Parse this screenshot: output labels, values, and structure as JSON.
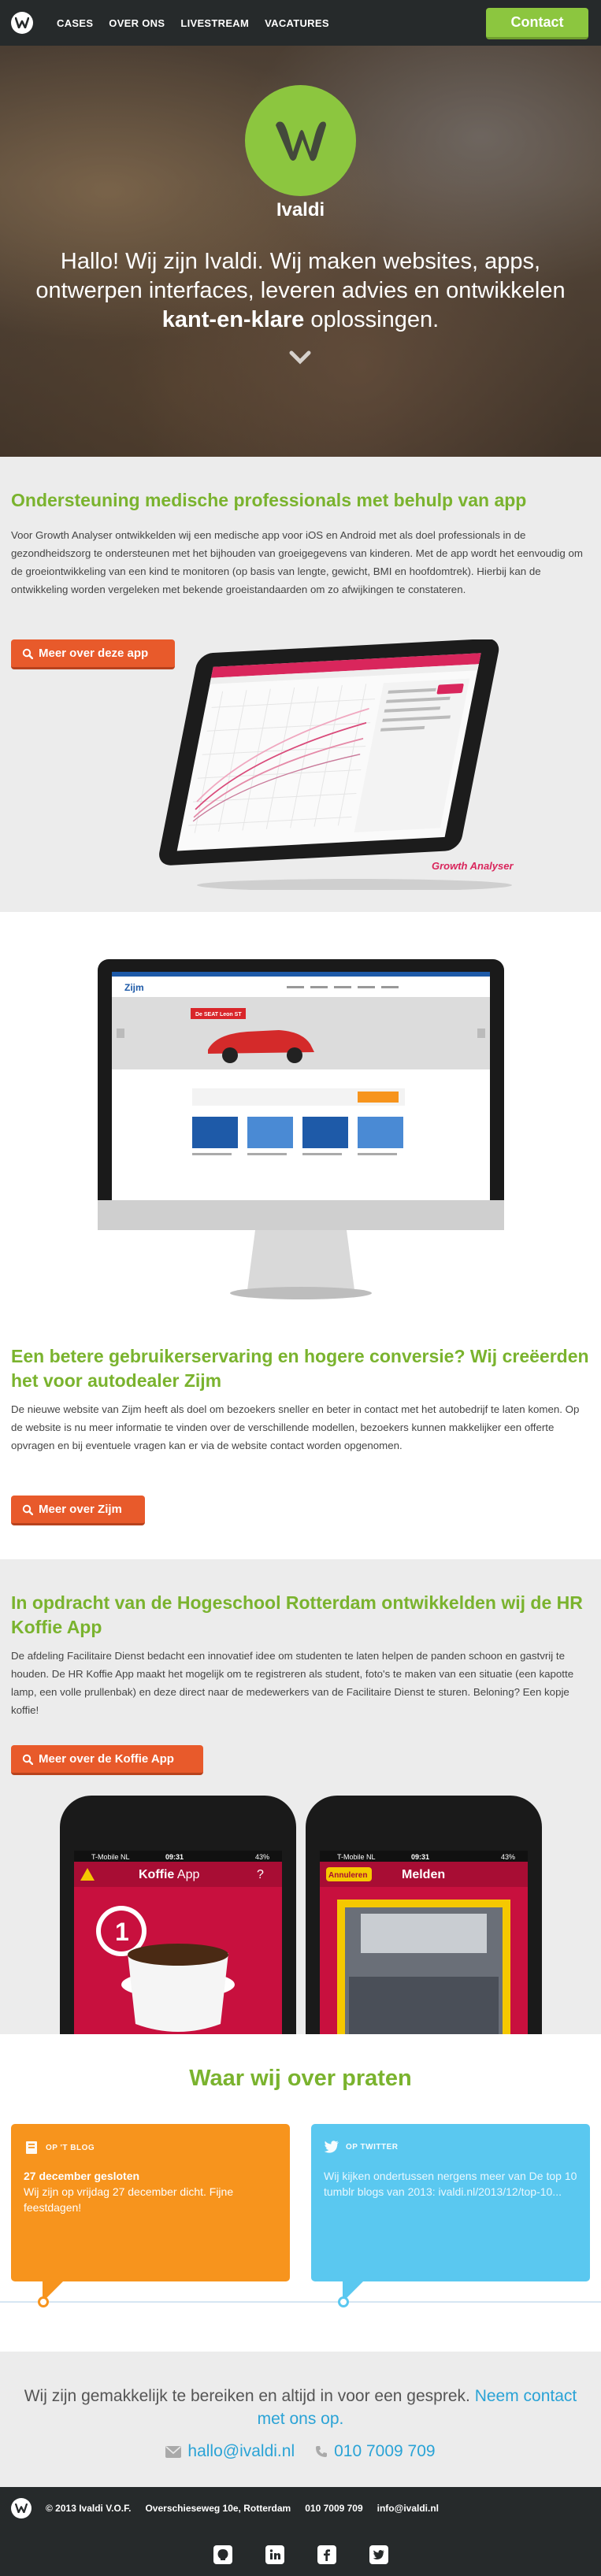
{
  "nav": {
    "links": [
      "CASES",
      "OVER ONS",
      "LIVESTREAM",
      "VACATURES"
    ],
    "contact_label": "Contact"
  },
  "hero": {
    "brand": "Ivaldi",
    "tagline_start": "Hallo! Wij zijn Ivaldi. Wij maken websites, apps, ontwerpen interfaces, leveren advies en ontwikkelen ",
    "tagline_bold": "kant-en-klare",
    "tagline_end": " oplossingen."
  },
  "case1": {
    "title": "Ondersteuning medische professionals met behulp van app",
    "text": "Voor Growth Analyser ontwikkelden wij een medische app voor iOS en Android met als doel professionals in de gezondheidszorg te ondersteunen met het bijhouden van groeigegevens van kinderen. Met de app wordt het eenvoudig om de groeiontwikkeling van een kind te monitoren (op basis van lengte, gewicht, BMI en hoofdomtrek). Hierbij kan de ontwikkeling worden vergeleken met bekende groeistandaarden om zo afwijkingen te constateren.",
    "button": "Meer over deze app",
    "app_brand": "Growth Analyser"
  },
  "case2": {
    "title": "Een betere gebruikerservaring en hogere conversie? Wij creëerden het voor autodealer Zijm",
    "text": "De nieuwe website van Zijm heeft als doel om bezoekers sneller en beter in contact met het autobedrijf te laten komen. Op de website is nu meer informatie te vinden over de verschillende modellen, bezoekers kunnen makkelijker een offerte opvragen en bij eventuele vragen kan er via de website contact worden opgenomen.",
    "button": "Meer over Zijm",
    "site_logo": "Zijm",
    "site_banner": "De SEAT Leon ST"
  },
  "case3": {
    "title": "In opdracht van de Hogeschool Rotterdam ontwikkelden wij de HR Koffie App",
    "text": "De afdeling Facilitaire Dienst bedacht een innovatief idee om studenten te laten helpen de panden schoon en gastvrij te houden. De HR Koffie App maakt het mogelijk om te registreren als student, foto's te maken van een situatie (een kapotte lamp, een volle prullenbak) en deze direct naar de medewerkers van de Facilitaire Dienst te sturen. Beloning? Een kopje koffie!",
    "button": "Meer over de Koffie App",
    "phone1": {
      "carrier": "T-Mobile NL",
      "time": "09:31",
      "battery": "43%",
      "title_bold": "Koffie",
      "title_rest": " App",
      "help": "?",
      "badge": "1"
    },
    "phone2": {
      "carrier": "T-Mobile NL",
      "time": "09:31",
      "battery": "43%",
      "cancel": "Annuleren",
      "title": "Melden"
    }
  },
  "talk": {
    "title": "Waar wij over praten",
    "blog": {
      "label": "OP 'T BLOG",
      "title": "27 december gesloten",
      "text": "Wij zijn op vrijdag 27 december dicht. Fijne feestdagen!"
    },
    "twitter": {
      "label": "OP TWITTER",
      "text": "Wij kijken ondertussen nergens meer van De top 10 tumblr blogs van 2013: ivaldi.nl/2013/12/top-10..."
    }
  },
  "contact": {
    "text": "Wij zijn gemakkelijk te bereiken en altijd in voor een gesprek.",
    "link": "Neem contact met ons op.",
    "email": "hallo@ivaldi.nl",
    "phone": "010 7009 709"
  },
  "footer": {
    "copyright": "© 2013 Ivaldi V.O.F.",
    "address": "Overschieseweg 10e, Rotterdam",
    "phone": "010 7009 709",
    "email": "info@ivaldi.nl",
    "social": [
      "github-icon",
      "linkedin-icon",
      "facebook-icon",
      "twitter-icon"
    ]
  },
  "colors": {
    "green": "#8cc63f",
    "orange": "#e85a2b",
    "dark": "#262a2b",
    "blue": "#2aa3d6"
  }
}
